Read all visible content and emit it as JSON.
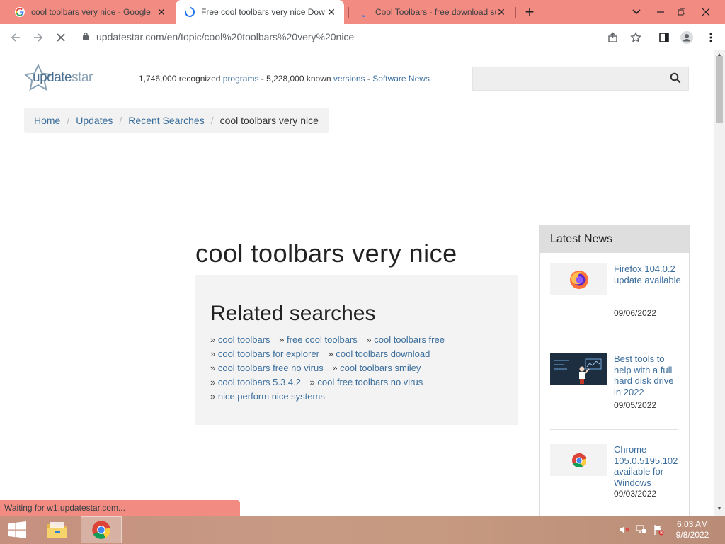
{
  "browser": {
    "tabs": [
      {
        "title": "cool toolbars very nice - Google",
        "icon": "google-icon",
        "active": false
      },
      {
        "title": "Free cool toolbars very nice Dow",
        "icon": "loading-spinner-icon",
        "active": true
      },
      {
        "title": "Cool Toolbars - free download su",
        "icon": "loading-dot-icon",
        "active": false
      }
    ],
    "close_glyph": "✕",
    "new_tab_glyph": "+",
    "url": "updatestar.com/en/topic/cool%20toolbars%20very%20nice",
    "status_text": "Waiting for w1.updatestar.com..."
  },
  "site": {
    "logo_text_main": "update",
    "logo_text_star": "star",
    "stats": {
      "programs_count": "1,746,000 recognized ",
      "programs_link": "programs",
      "dash1": " - ",
      "versions_count": "5,228,000 known ",
      "versions_link": "versions",
      "dash2": " - ",
      "news_link": "Software News"
    },
    "search_placeholder": ""
  },
  "breadcrumb": {
    "home": "Home",
    "updates": "Updates",
    "recent": "Recent Searches",
    "current": "cool toolbars very nice",
    "sep": "/"
  },
  "main": {
    "title": "cool toolbars very nice",
    "related_heading": "Related searches",
    "bullet": "» ",
    "related": [
      "cool toolbars",
      "free cool toolbars",
      "cool toolbars free",
      "cool toolbars for explorer",
      "cool toolbars download",
      "cool toolbars free no virus",
      "cool toolbars smiley",
      "cool toolbars 5.3.4.2",
      "cool free toolbars no virus",
      "nice perform nice systems"
    ]
  },
  "news": {
    "heading": "Latest News",
    "items": [
      {
        "title": "Firefox 104.0.2 update available",
        "date": "09/06/2022",
        "thumb": "firefox-logo"
      },
      {
        "title": "Best tools to help with a full hard disk drive in 2022",
        "date": "09/05/2022",
        "thumb": "chalkboard-illustration"
      },
      {
        "title": "Chrome 105.0.5195.102 available for Windows",
        "date": "09/03/2022",
        "thumb": "chrome-logo"
      }
    ]
  },
  "taskbar": {
    "time": "6:03 AM",
    "date": "9/8/2022"
  },
  "colors": {
    "tabbar": "#f28b82",
    "link": "#3a6d9c"
  }
}
